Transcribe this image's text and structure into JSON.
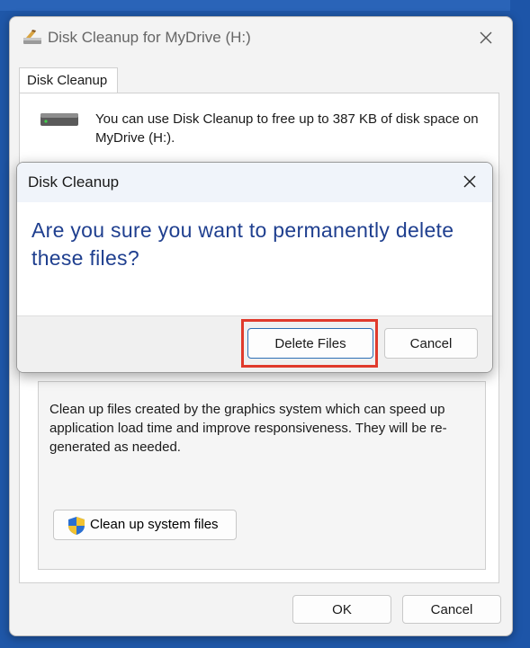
{
  "window": {
    "title": "Disk Cleanup for MyDrive (H:)",
    "tab_label": "Disk Cleanup",
    "info_text": "You can use Disk Cleanup to free up to 387 KB of disk space on MyDrive (H:).",
    "description": "Clean up files created by the graphics system which can speed up application load time and improve responsiveness. They will be re-generated as needed.",
    "system_files_button": "Clean up system files",
    "ok_label": "OK",
    "cancel_label": "Cancel"
  },
  "dialog": {
    "title": "Disk Cleanup",
    "question": "Are you sure you want to permanently delete these files?",
    "delete_label": "Delete Files",
    "cancel_label": "Cancel"
  },
  "icons": {
    "app": "disk-cleanup-icon",
    "close": "close-icon",
    "drive": "drive-icon",
    "shield": "uac-shield-icon"
  },
  "colors": {
    "desktop": "#1f57a8",
    "question_text": "#1f3f8f",
    "highlight": "#e03a2c",
    "primary_border": "#2d6fb5"
  }
}
